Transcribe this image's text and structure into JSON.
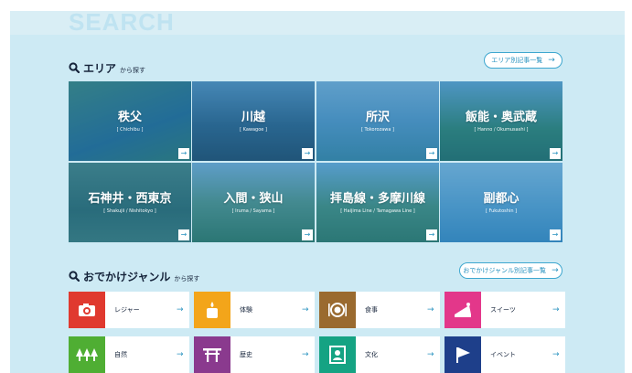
{
  "header": {
    "big_title": "SEARCH"
  },
  "area_section": {
    "heading_main": "エリア",
    "heading_sub": "から探す",
    "all_button_label": "エリア別記事一覧",
    "arrow": "→",
    "tiles": [
      {
        "name": "秩父",
        "roman": "[ Chichibu ]",
        "arrow": "→"
      },
      {
        "name": "川越",
        "roman": "[ Kawagoe ]",
        "arrow": "→"
      },
      {
        "name": "所沢",
        "roman": "[ Tokorozawa ]",
        "arrow": "→"
      },
      {
        "name": "飯能・奥武蔵",
        "roman": "[ Hanno / Okumusashi ]",
        "arrow": "→"
      },
      {
        "name": "石神井・西東京",
        "roman": "[ Shakujii / Nishitokyo ]",
        "arrow": "→"
      },
      {
        "name": "入間・狭山",
        "roman": "[ Iruma / Sayama ]",
        "arrow": "→"
      },
      {
        "name": "拝島線・多摩川線",
        "roman": "[ Haijima Line / Tamagawa Line ]",
        "arrow": "→"
      },
      {
        "name": "副都心",
        "roman": "[ Fukutoshin ]",
        "arrow": "→"
      }
    ]
  },
  "genre_section": {
    "heading_main": "おでかけジャンル",
    "heading_sub": "から探す",
    "all_button_label": "おでかけジャンル別記事一覧",
    "arrow": "→",
    "items": [
      {
        "label": "レジャー",
        "icon": "camera-icon",
        "color": "#e0392f",
        "arrow": "→"
      },
      {
        "label": "体験",
        "icon": "candle-icon",
        "color": "#f3a51a",
        "arrow": "→"
      },
      {
        "label": "食事",
        "icon": "plate-icon",
        "color": "#9a6a2f",
        "arrow": "→"
      },
      {
        "label": "スイーツ",
        "icon": "cake-icon",
        "color": "#e3378a",
        "arrow": "→"
      },
      {
        "label": "自然",
        "icon": "trees-icon",
        "color": "#4fae33",
        "arrow": "→"
      },
      {
        "label": "歴史",
        "icon": "torii-icon",
        "color": "#8a3a8e",
        "arrow": "→"
      },
      {
        "label": "文化",
        "icon": "portrait-icon",
        "color": "#15a383",
        "arrow": "→"
      },
      {
        "label": "イベント",
        "icon": "flag-icon",
        "color": "#1e3f8a",
        "arrow": "→"
      }
    ]
  }
}
